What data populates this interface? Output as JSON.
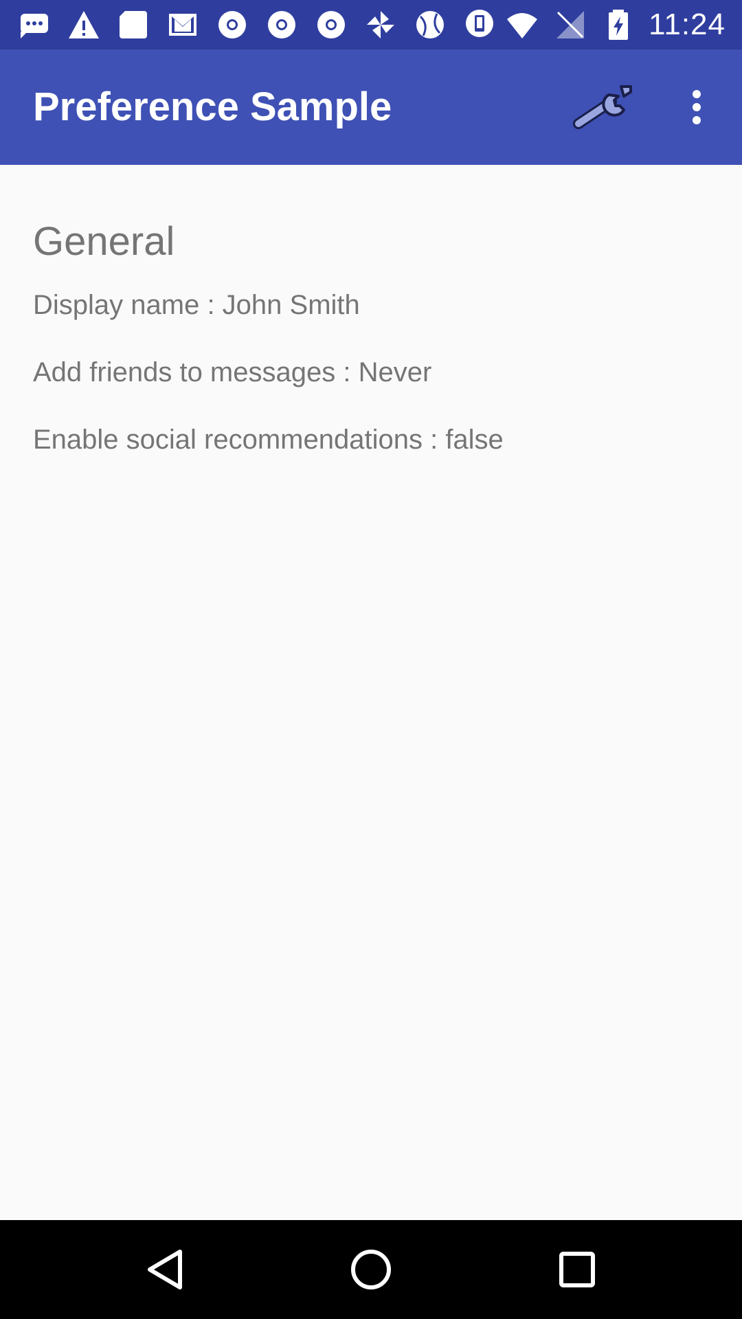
{
  "status_bar": {
    "time": "11:24",
    "left_icons": [
      "sms-icon",
      "warning-icon",
      "sd-card-icon",
      "gmail-icon",
      "chrome-icon",
      "chrome-icon",
      "chrome-icon",
      "pinwheel-icon",
      "ball-icon",
      "device-icon"
    ],
    "right_icons": [
      "wifi-icon",
      "no-signal-icon",
      "battery-charging-icon"
    ],
    "background_color": "#2f3e9e"
  },
  "app_bar": {
    "title": "Preference Sample",
    "background_color": "#3f51b5",
    "actions": [
      "wrench-icon",
      "overflow-menu-icon"
    ]
  },
  "content": {
    "section_title": "General",
    "preferences": [
      "Display name : John Smith",
      "Add friends to messages : Never",
      "Enable social recommendations : false"
    ]
  },
  "nav_bar": {
    "buttons": [
      "back-icon",
      "home-icon",
      "recents-icon"
    ]
  }
}
